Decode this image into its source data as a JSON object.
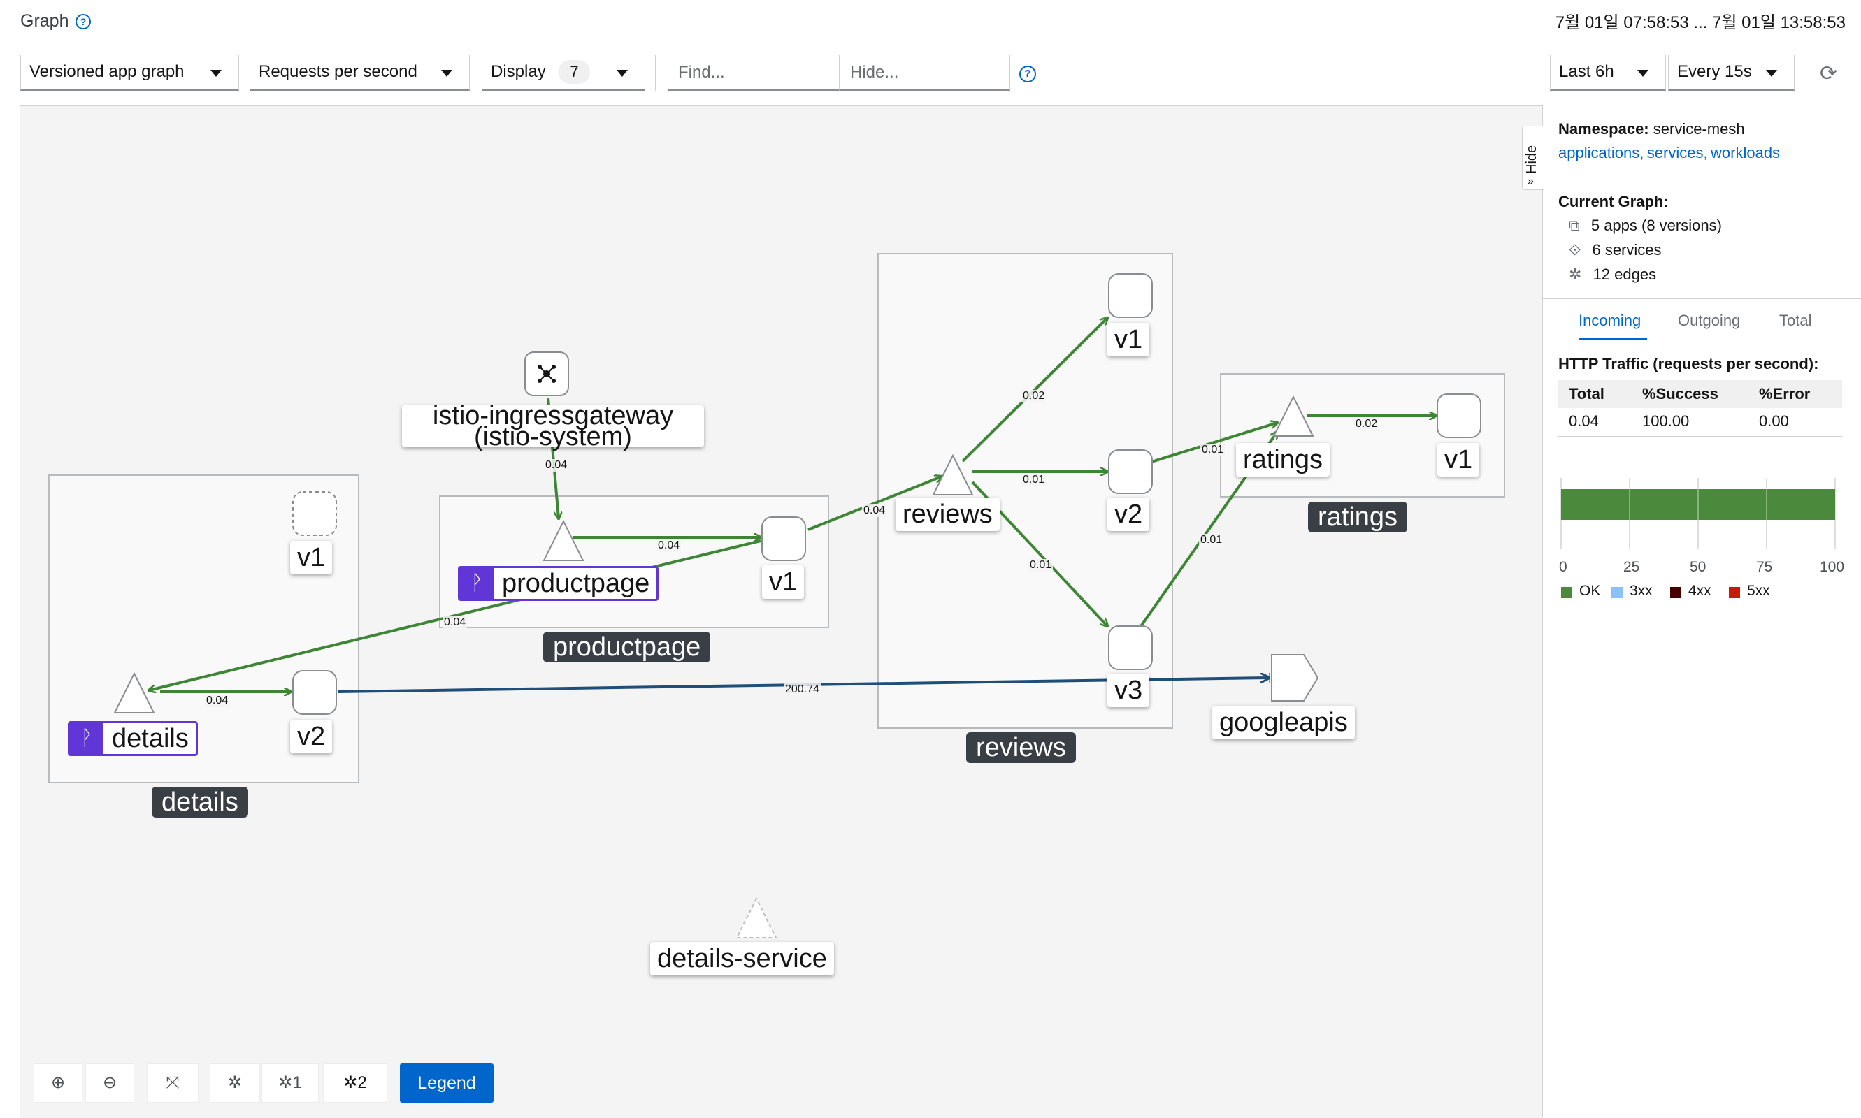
{
  "header": {
    "title": "Graph",
    "time_range": "7월 01일 07:58:53 ... 7월 01일 13:58:53"
  },
  "toolbar": {
    "graph_type": "Versioned app graph",
    "edge_label": "Requests per second",
    "display_label": "Display",
    "display_count": "7",
    "find_placeholder": "Find...",
    "hide_placeholder": "Hide...",
    "duration": "Last 6h",
    "refresh_interval": "Every 15s"
  },
  "graph": {
    "boxes": {
      "details": "details",
      "productpage": "productpage",
      "reviews": "reviews",
      "ratings": "ratings"
    },
    "nodes": {
      "ingress_line1": "istio-ingressgateway",
      "ingress_line2": "(istio-system)",
      "productpage_service": "productpage",
      "productpage_v1": "v1",
      "details_service": "details",
      "details_v1": "v1",
      "details_v2": "v2",
      "reviews_service": "reviews",
      "reviews_v1": "v1",
      "reviews_v2": "v2",
      "reviews_v3": "v3",
      "ratings_service": "ratings",
      "ratings_v1": "v1",
      "googleapis": "googleapis",
      "details_service_orphan": "details-service"
    },
    "edges": {
      "ingress_to_productpage": "0.04",
      "productpage_svc_to_v1": "0.04",
      "productpage_to_details": "0.04",
      "productpage_to_reviews": "0.04",
      "details_svc_to_v2": "0.04",
      "details_v2_to_googleapis": "200.74",
      "reviews_to_v1": "0.02",
      "reviews_to_v2": "0.01",
      "reviews_to_v3": "0.01",
      "reviews_v2_to_ratings": "0.01",
      "reviews_v3_to_ratings": "0.01",
      "ratings_svc_to_v1": "0.02"
    },
    "colors": {
      "ok_edge": "#3e8635",
      "tcp_edge": "#1f4e79",
      "virtual_service": "#6136d6",
      "box_label_bg": "#393f44"
    }
  },
  "bottom_toolbar": {
    "layout_1": "1",
    "layout_2": "2",
    "legend": "Legend"
  },
  "side_panel": {
    "hide_tab": "Hide",
    "namespace_label": "Namespace:",
    "namespace_value": "service-mesh",
    "links": {
      "applications": "applications,",
      "services": "services,",
      "workloads": "workloads"
    },
    "current_graph_label": "Current Graph:",
    "apps": "5 apps (8 versions)",
    "services": "6 services",
    "edges": "12 edges",
    "tabs": [
      "Incoming",
      "Outgoing",
      "Total"
    ],
    "traffic_title": "HTTP Traffic (requests per second):",
    "table": {
      "headers": [
        "Total",
        "%Success",
        "%Error"
      ],
      "row": [
        "0.04",
        "100.00",
        "0.00"
      ]
    },
    "chart": {
      "ticks": [
        "0",
        "25",
        "50",
        "75",
        "100"
      ],
      "legend": [
        "OK",
        "3xx",
        "4xx",
        "5xx"
      ],
      "colors": [
        "#4b8a3c",
        "#8bc1f7",
        "#470000",
        "#c9190b"
      ]
    }
  },
  "chart_data": {
    "type": "bar",
    "categories": [
      ""
    ],
    "series": [
      {
        "name": "OK",
        "values": [
          100
        ]
      },
      {
        "name": "3xx",
        "values": [
          0
        ]
      },
      {
        "name": "4xx",
        "values": [
          0
        ]
      },
      {
        "name": "5xx",
        "values": [
          0
        ]
      }
    ],
    "xlim": [
      0,
      100
    ],
    "ticks": [
      0,
      25,
      50,
      75,
      100
    ],
    "legend_position": "bottom"
  }
}
